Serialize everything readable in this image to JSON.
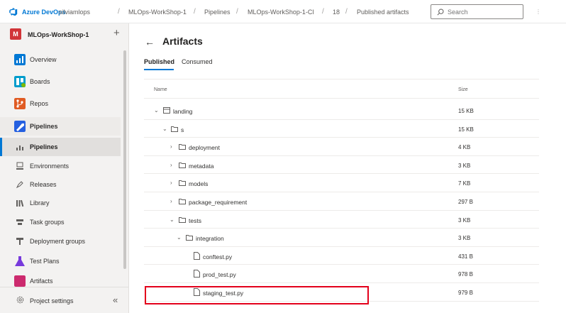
{
  "topbar": {
    "brand": "Azure DevOps",
    "breadcrumbs": [
      "silviamlops",
      "MLOps-WorkShop-1",
      "Pipelines",
      "MLOps-WorkShop-1-CI",
      "18",
      "Published artifacts"
    ],
    "search_placeholder": "Search",
    "icons": {
      "logo": "azure-devops-logo-icon",
      "search": "search-icon",
      "more": "more-icon"
    }
  },
  "sidebar": {
    "project_badge": "M",
    "project_name": "MLOps-WorkShop-1",
    "add_label": "+",
    "items": [
      {
        "label": "Overview",
        "icon": "overview-icon",
        "color": "#0078d4"
      },
      {
        "label": "Boards",
        "icon": "boards-icon",
        "color": "#009ccc"
      },
      {
        "label": "Repos",
        "icon": "repos-icon",
        "color": "#e05b23"
      },
      {
        "label": "Pipelines",
        "icon": "pipelines-icon",
        "color": "#2560e0"
      },
      {
        "label": "Pipelines",
        "icon": "pipelines-sub-icon"
      },
      {
        "label": "Environments",
        "icon": "environments-icon"
      },
      {
        "label": "Releases",
        "icon": "releases-icon"
      },
      {
        "label": "Library",
        "icon": "library-icon"
      },
      {
        "label": "Task groups",
        "icon": "task-groups-icon"
      },
      {
        "label": "Deployment groups",
        "icon": "deployment-groups-icon"
      },
      {
        "label": "Test Plans",
        "icon": "test-plans-icon",
        "color": "#773adc"
      },
      {
        "label": "Artifacts",
        "icon": "artifacts-icon",
        "color": "#cc2a6e"
      }
    ],
    "settings_label": "Project settings",
    "collapse_label": "«"
  },
  "main": {
    "back_label": "←",
    "title": "Artifacts",
    "tabs": [
      "Published",
      "Consumed"
    ],
    "columns": {
      "name": "Name",
      "size": "Size"
    },
    "rows": [
      {
        "name": "landing",
        "size": "15 KB",
        "type": "artifact",
        "expanded": true
      },
      {
        "name": "s",
        "size": "15 KB",
        "type": "folder",
        "expanded": true
      },
      {
        "name": "deployment",
        "size": "4 KB",
        "type": "folder",
        "expanded": false
      },
      {
        "name": "metadata",
        "size": "3 KB",
        "type": "folder",
        "expanded": false
      },
      {
        "name": "models",
        "size": "7 KB",
        "type": "folder",
        "expanded": false
      },
      {
        "name": "package_requirement",
        "size": "297 B",
        "type": "folder",
        "expanded": false
      },
      {
        "name": "tests",
        "size": "3 KB",
        "type": "folder",
        "expanded": true
      },
      {
        "name": "integration",
        "size": "3 KB",
        "type": "folder",
        "expanded": true
      },
      {
        "name": "conftest.py",
        "size": "431 B",
        "type": "file"
      },
      {
        "name": "prod_test.py",
        "size": "978 B",
        "type": "file"
      },
      {
        "name": "staging_test.py",
        "size": "979 B",
        "type": "file"
      }
    ],
    "highlight_color": "#e3001b"
  }
}
